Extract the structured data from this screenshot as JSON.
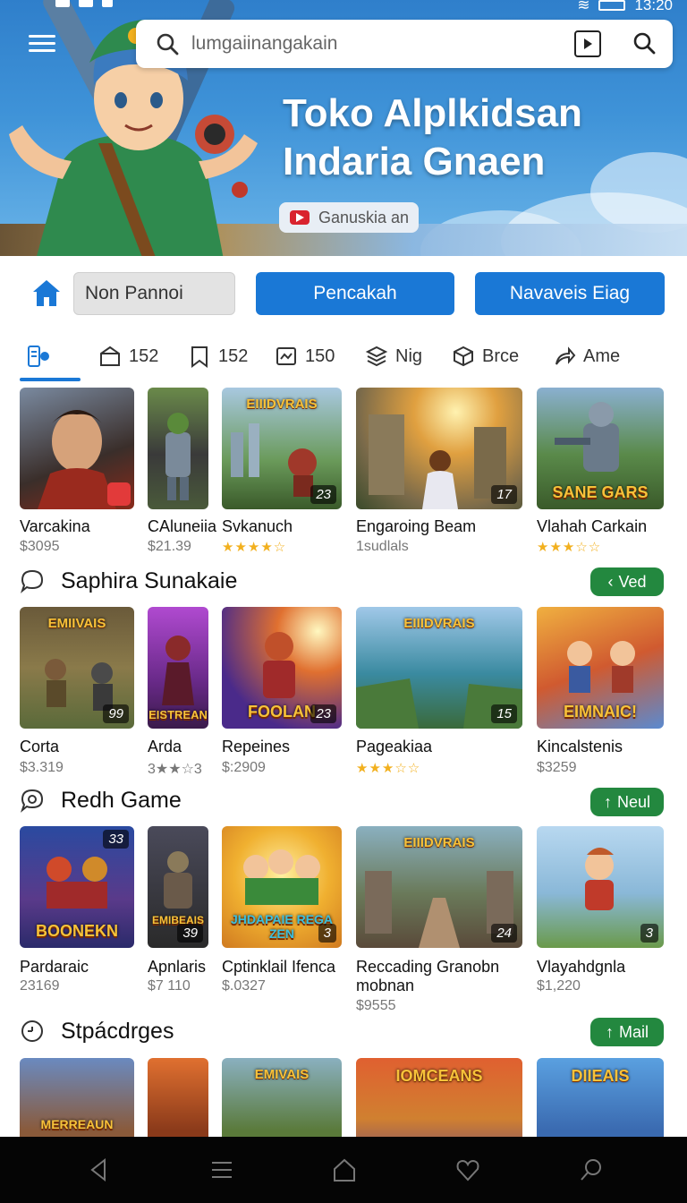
{
  "status_bar": {
    "time": "13:20"
  },
  "search": {
    "placeholder": "lumgaiinangakain"
  },
  "hero": {
    "title_line1": "Toko Alplkidsan",
    "title_line2": "Indaria Gnaen",
    "button_label": "Ganuskia an"
  },
  "filters": {
    "chip_grey": "Non Pannoi",
    "chip_blue1": "Pencakah",
    "chip_blue2": "Navaveis Eiag"
  },
  "tabs": [
    {
      "label": "",
      "icon": "apps-icon"
    },
    {
      "label": "152",
      "icon": "box-icon"
    },
    {
      "label": "152",
      "icon": "bookmark-icon"
    },
    {
      "label": "150",
      "icon": "image-icon"
    },
    {
      "label": "Nig",
      "icon": "layers-icon"
    },
    {
      "label": "Brce",
      "icon": "cube-icon"
    },
    {
      "label": "Ame",
      "icon": "share-icon"
    }
  ],
  "row1": [
    {
      "name": "Varcakina",
      "price": "$3095",
      "badge": ""
    },
    {
      "name": "CAluneiia",
      "price": "$21.39",
      "badge": ""
    },
    {
      "name": "Svkanuch",
      "rating": "★★★★☆",
      "badge": "23",
      "art_top": "EIIIDVRAIS",
      "art_bottom": ""
    },
    {
      "name": "Engaroing Beam",
      "price": "1sudlals",
      "badge": "17"
    },
    {
      "name": "Vlahah Carkain",
      "rating": "★★★☆☆",
      "badge": "",
      "art_bottom": "SANE GARS"
    }
  ],
  "section1": {
    "title": "Saphira Sunakaie",
    "action": "Ved"
  },
  "row2": [
    {
      "name": "Corta",
      "price": "$3.319",
      "badge": "99",
      "art_top": "EMIIVAIS"
    },
    {
      "name": "Arda",
      "price": "3★★☆3",
      "badge": "",
      "art_bottom": "EISTREAN"
    },
    {
      "name": "Repeines",
      "price": "$:2909",
      "badge": "23",
      "art_bottom": "FOOLAN"
    },
    {
      "name": "Pageakiaa",
      "rating": "★★★☆☆",
      "badge": "15",
      "art_top": "EIIIDVRAIS"
    },
    {
      "name": "Kincalstenis",
      "price": "$3259",
      "badge": "",
      "art_bottom": "EIMNAIC!"
    }
  ],
  "section2": {
    "title": "Redh Game",
    "action": "Neul"
  },
  "row3": [
    {
      "name": "Pardaraic",
      "price": "23169",
      "badge": "33",
      "art_bottom": "BOONEKN"
    },
    {
      "name": "Apnlaris",
      "price": "$7 110",
      "badge": "39",
      "art_bottom": "EMIBEAIS"
    },
    {
      "name": "Cptinklail Ifenca",
      "price": "$.0327",
      "badge": "3",
      "art_bottom": "JHDAPAIE REGA ZEN"
    },
    {
      "name": "Reccading Granobn",
      "name2": "mobnan",
      "price": "$9555",
      "badge": "24",
      "art_top": "EIIIDVRAIS"
    },
    {
      "name": "Vlayahdgnla",
      "price": "$1,220",
      "badge": "3"
    }
  ],
  "section3": {
    "title": "Stpácdrges",
    "action": "Mail"
  },
  "row4": [
    {
      "art_bottom": "MERREAUN"
    },
    {
      "art_bottom": ""
    },
    {
      "art_top": "EMIVAIS"
    },
    {
      "art_top": "IOMCEANS"
    },
    {
      "art_top": "DIIEAIS"
    }
  ],
  "colors": {
    "accent": "#1a78d6",
    "pill": "#23883f",
    "star": "#f2b01e",
    "navbar": "#050505"
  }
}
